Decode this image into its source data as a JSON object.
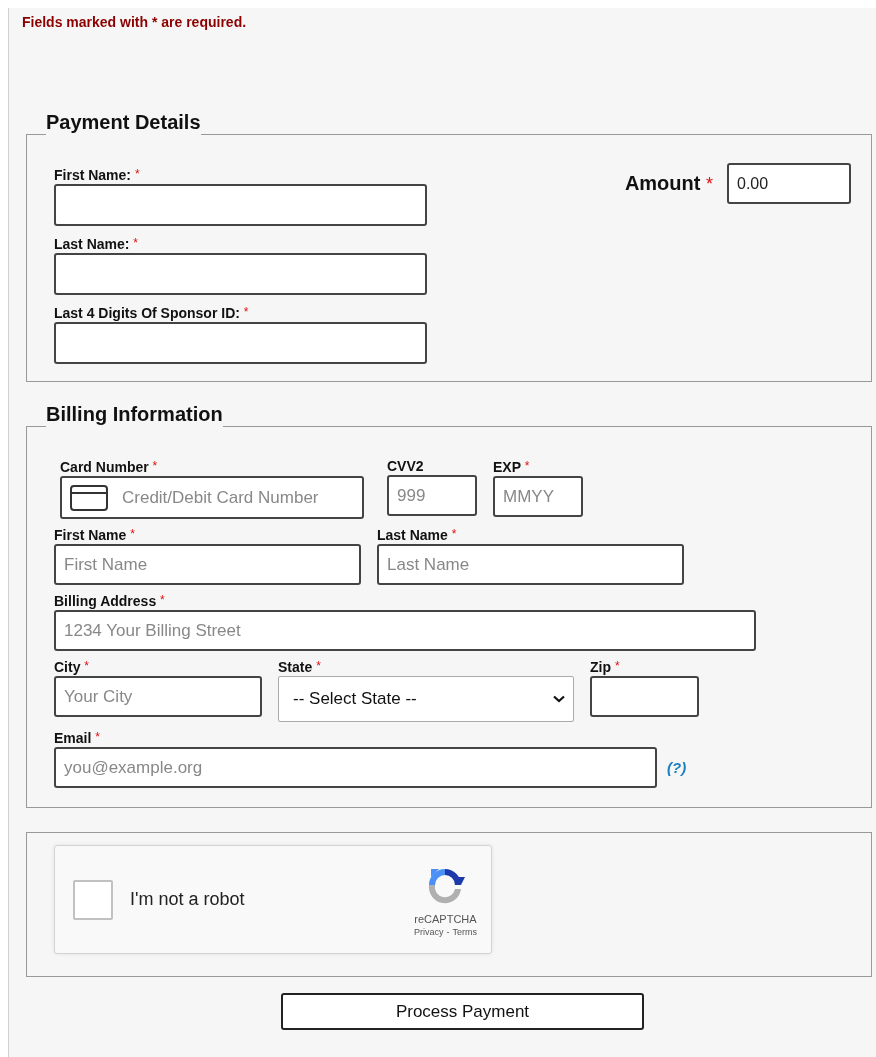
{
  "notice": "Fields marked with * are required.",
  "payment_details": {
    "legend": "Payment Details",
    "fields": [
      {
        "label": "First Name:",
        "marker": "*"
      },
      {
        "label": "Last Name:",
        "marker": "*"
      },
      {
        "label": "Last 4 Digits Of Sponsor ID:",
        "marker": "*"
      }
    ],
    "amount": {
      "label": "Amount",
      "marker": "*",
      "value": "0.00"
    }
  },
  "billing_information": {
    "legend": "Billing Information",
    "rows": [
      {
        "fields": [
          {
            "kind": "card",
            "label": "Card Number",
            "marker": "*",
            "placeholder": "Credit/Debit Card Number"
          },
          {
            "kind": "text",
            "label": "CVV2",
            "placeholder": "999"
          },
          {
            "kind": "text",
            "label": "EXP",
            "marker": "*",
            "placeholder": "MMYY"
          }
        ]
      },
      {
        "fields": [
          {
            "kind": "text",
            "label": "First Name",
            "marker": "*",
            "placeholder": "First Name"
          },
          {
            "kind": "text",
            "label": "Last Name",
            "marker": "*",
            "placeholder": "Last Name"
          }
        ]
      },
      {
        "fields": [
          {
            "kind": "text",
            "label": "Billing Address",
            "marker": "*",
            "placeholder": "1234 Your Billing Street"
          }
        ]
      },
      {
        "fields": [
          {
            "kind": "text",
            "label": "City",
            "marker": "*",
            "placeholder": "Your City"
          },
          {
            "kind": "select",
            "label": "State",
            "marker": "*",
            "value": "-- Select State --"
          },
          {
            "kind": "text",
            "label": "Zip",
            "marker": "*"
          }
        ]
      },
      {
        "fields": [
          {
            "kind": "text",
            "label": "Email",
            "marker": "*",
            "placeholder": "you@example.org",
            "help": "(?)"
          }
        ]
      }
    ]
  },
  "captcha": {
    "checked": false,
    "label": "I'm not a robot",
    "brand": "reCAPTCHA",
    "links": [
      "Privacy",
      "Terms"
    ],
    "separator": "-"
  },
  "submit": "Process Payment"
}
